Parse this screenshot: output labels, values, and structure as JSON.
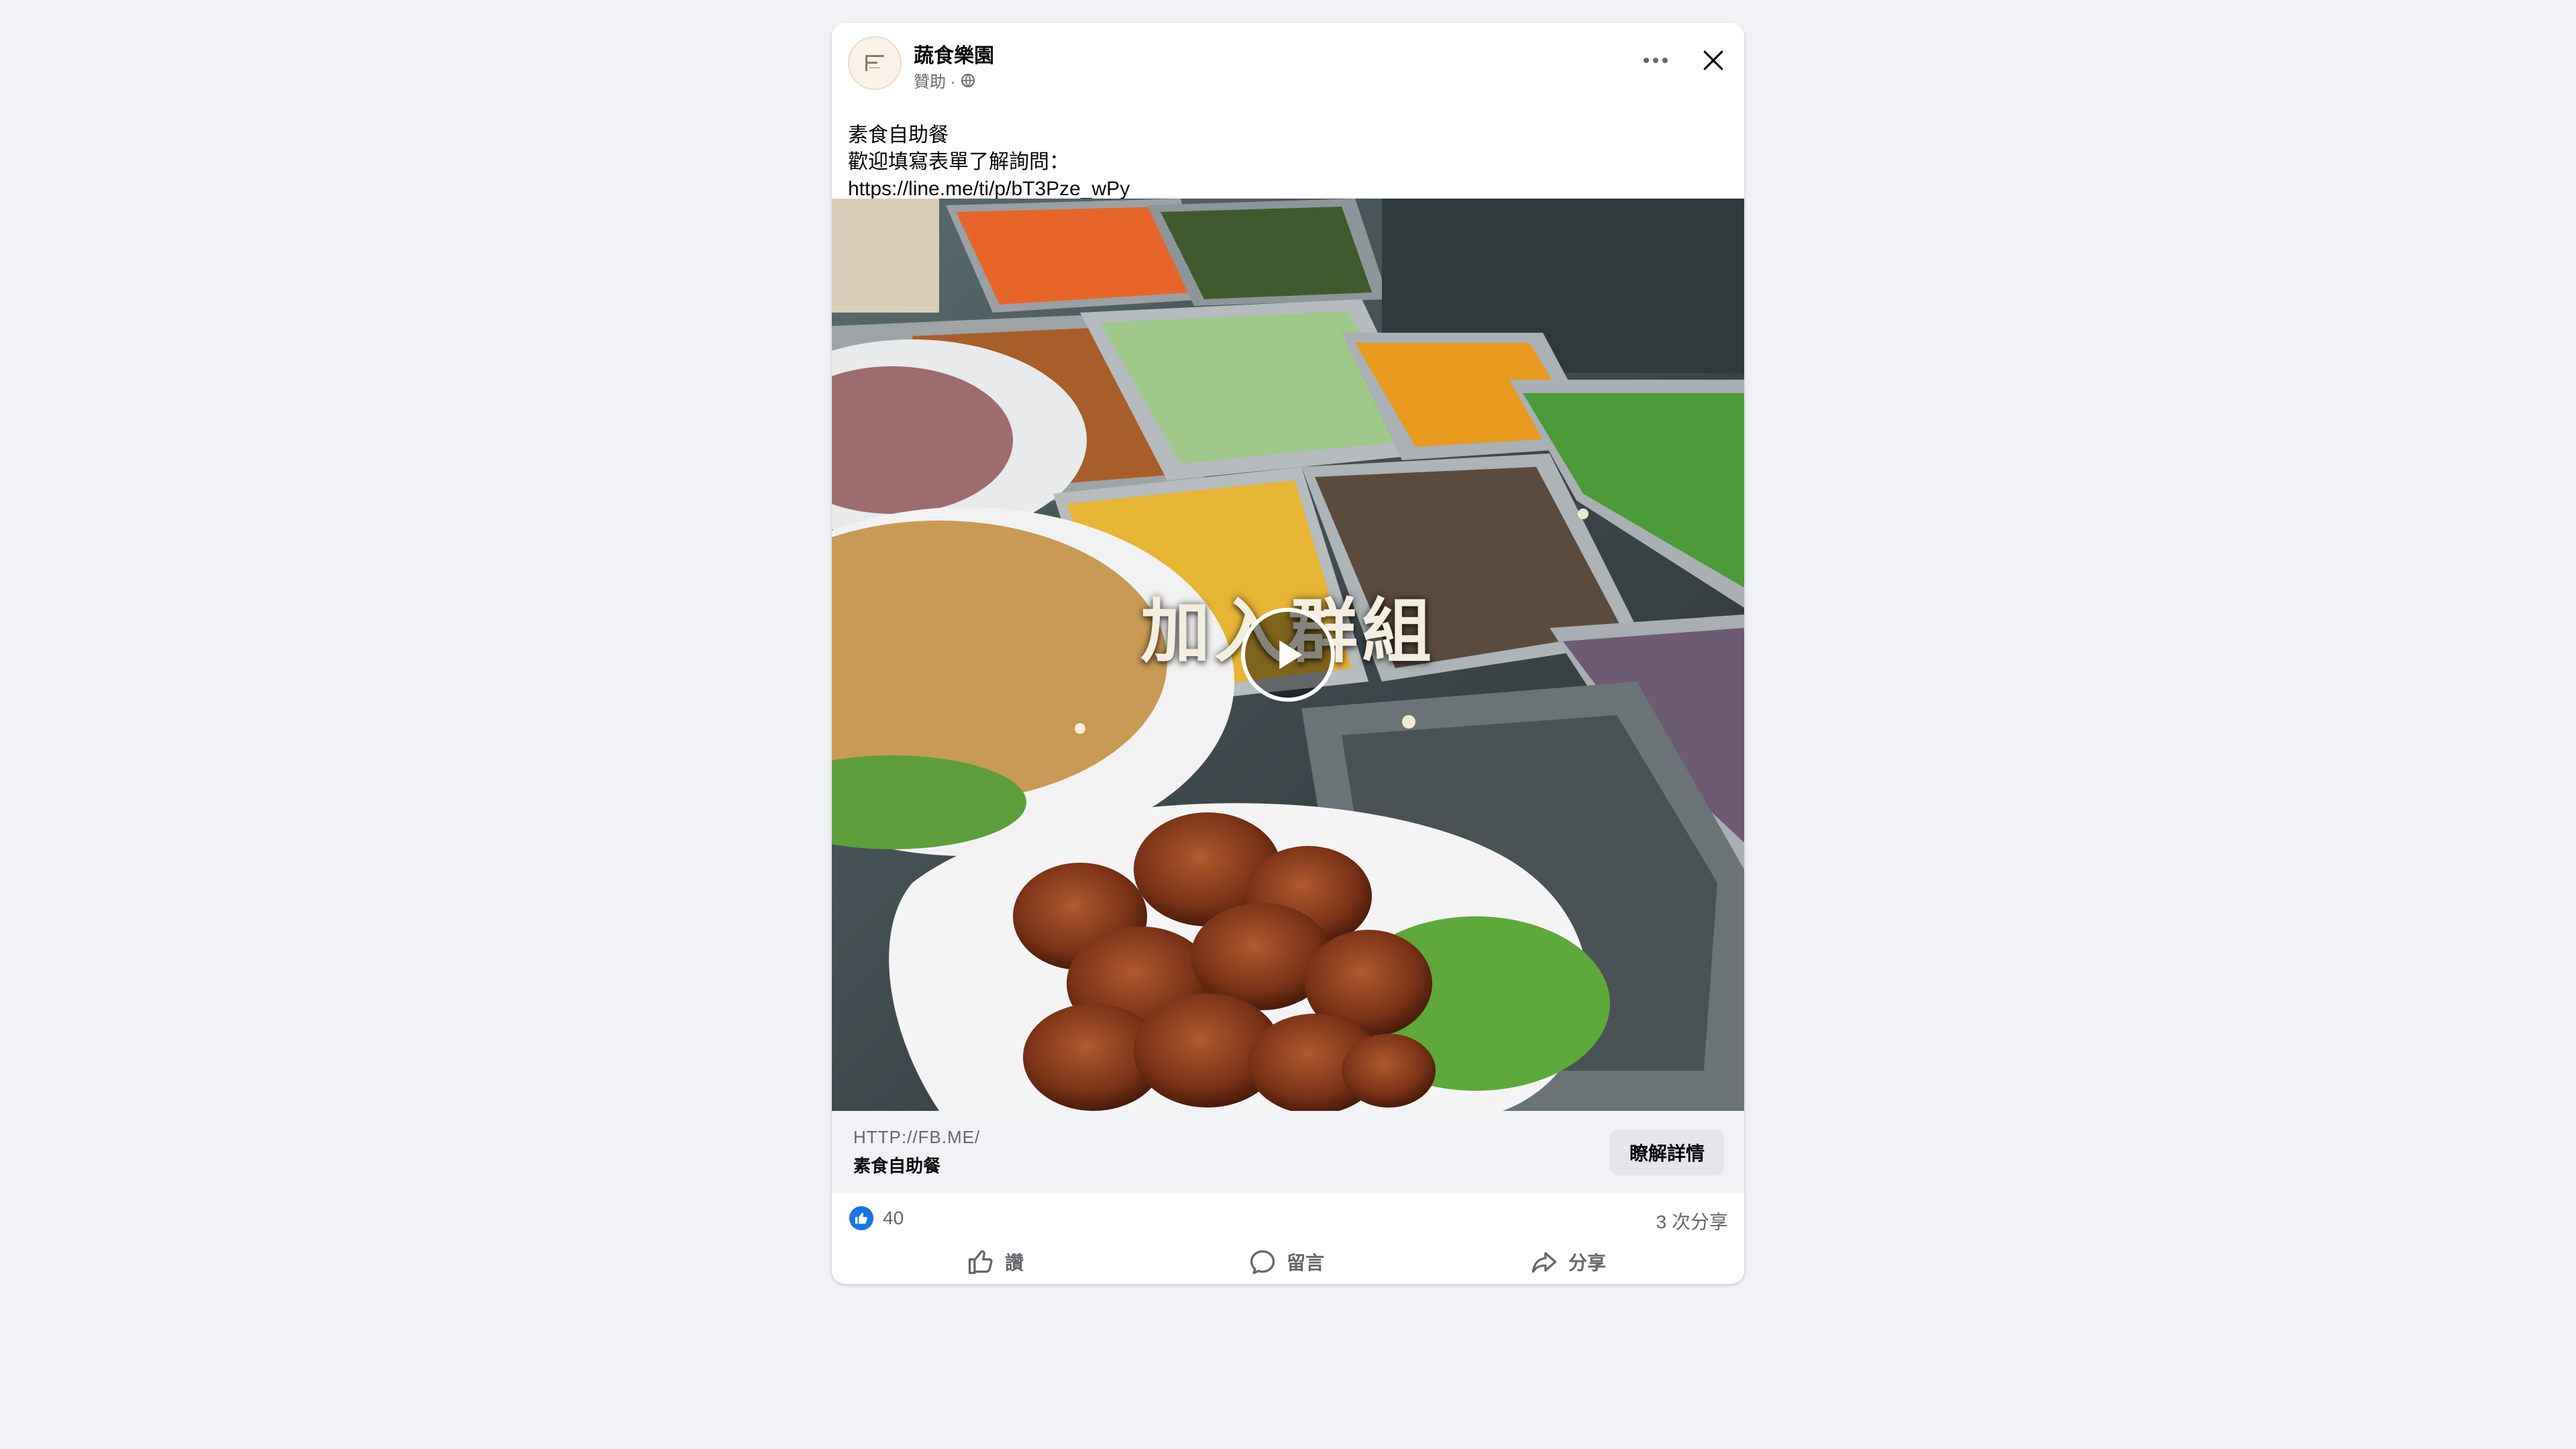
{
  "post": {
    "page_name": "蔬食樂園",
    "sponsored_label": "贊助 ·",
    "caption_lines": [
      "素食自助餐",
      "歡迎填寫表單了解詢問：",
      "https://line.me/ti/p/bT3Pze_wPy"
    ],
    "media": {
      "overlay_text": "加入群組",
      "play_icon": "play-icon"
    },
    "link": {
      "domain": "HTTP://FB.ME/",
      "title": "素食自助餐",
      "cta_label": "瞭解詳情"
    },
    "stats": {
      "like_count": "40",
      "share_count": "3 次分享"
    },
    "actions": {
      "like_label": "讚",
      "comment_label": "留言",
      "share_label": "分享"
    }
  },
  "colors": {
    "background": "#f0f2f5",
    "card": "#ffffff",
    "like_blue": "#1b74e4",
    "secondary_text": "#65676b"
  }
}
